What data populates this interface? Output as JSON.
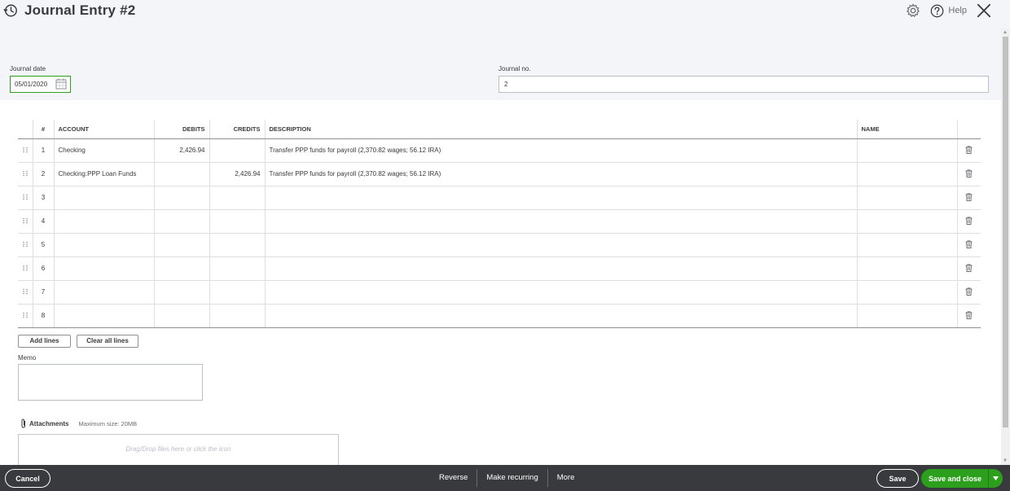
{
  "header": {
    "title": "Journal Entry #2",
    "help_label": "Help"
  },
  "form": {
    "journal_date_label": "Journal date",
    "journal_date_value": "05/01/2020",
    "journal_no_label": "Journal no.",
    "journal_no_value": "2"
  },
  "table": {
    "columns": {
      "num": "#",
      "account": "ACCOUNT",
      "debits": "DEBITS",
      "credits": "CREDITS",
      "description": "DESCRIPTION",
      "name": "NAME"
    },
    "rows": [
      {
        "num": "1",
        "account": "Checking",
        "debits": "2,426.94",
        "credits": "",
        "description": "Transfer PPP funds for payroll (2,370.82 wages; 56.12 IRA)",
        "name": ""
      },
      {
        "num": "2",
        "account": "Checking:PPP Loan Funds",
        "debits": "",
        "credits": "2,426.94",
        "description": "Transfer PPP funds for payroll (2,370.82 wages; 56.12 IRA)",
        "name": ""
      },
      {
        "num": "3",
        "account": "",
        "debits": "",
        "credits": "",
        "description": "",
        "name": ""
      },
      {
        "num": "4",
        "account": "",
        "debits": "",
        "credits": "",
        "description": "",
        "name": ""
      },
      {
        "num": "5",
        "account": "",
        "debits": "",
        "credits": "",
        "description": "",
        "name": ""
      },
      {
        "num": "6",
        "account": "",
        "debits": "",
        "credits": "",
        "description": "",
        "name": ""
      },
      {
        "num": "7",
        "account": "",
        "debits": "",
        "credits": "",
        "description": "",
        "name": ""
      },
      {
        "num": "8",
        "account": "",
        "debits": "",
        "credits": "",
        "description": "",
        "name": ""
      }
    ]
  },
  "actions": {
    "add_lines": "Add lines",
    "clear_all_lines": "Clear all lines"
  },
  "memo": {
    "label": "Memo"
  },
  "attachments": {
    "label": "Attachments",
    "max_size": "Maximum size: 20MB",
    "dropzone_text": "Drag/Drop files here or click the icon"
  },
  "footer": {
    "cancel": "Cancel",
    "reverse": "Reverse",
    "make_recurring": "Make recurring",
    "more": "More",
    "save": "Save",
    "save_and_close": "Save and close"
  },
  "colors": {
    "accent_green": "#2ca01c",
    "footer_bg": "#393a3d",
    "header_bg": "#f4f5f8"
  },
  "icons": [
    "history-icon",
    "gear-icon",
    "help-icon",
    "close-icon",
    "calendar-icon",
    "drag-handle-icon",
    "trash-icon",
    "paperclip-icon",
    "caret-down-icon"
  ]
}
